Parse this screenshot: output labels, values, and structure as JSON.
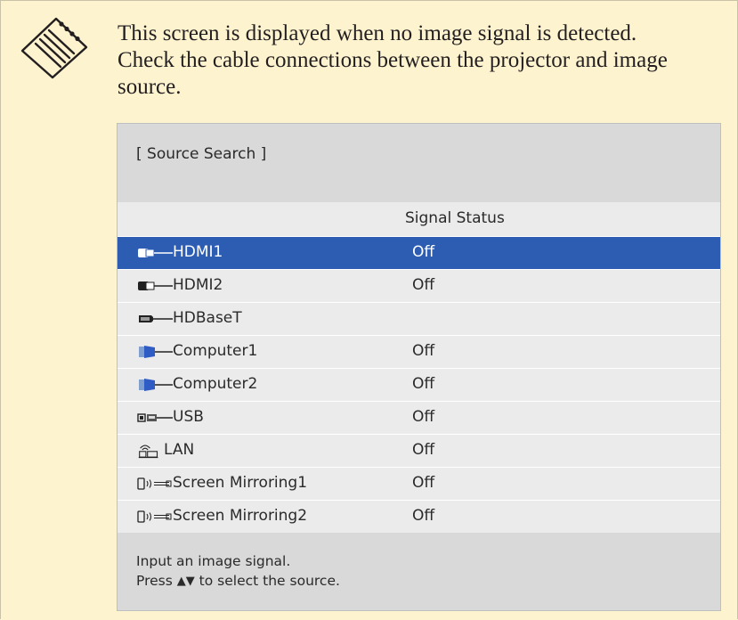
{
  "note": {
    "icon": "notepad-icon",
    "text_lines": [
      "This screen is displayed when no image signal is detected.",
      "Check the cable connections between the projector and image",
      "source."
    ]
  },
  "osd": {
    "title": "[ Source Search ]",
    "column_header": "Signal Status",
    "sources": [
      {
        "label": "HDMI1",
        "status": "Off",
        "icon": "hdmi-icon",
        "selected": true
      },
      {
        "label": "HDMI2",
        "status": "Off",
        "icon": "hdmi-icon",
        "selected": false
      },
      {
        "label": "HDBaseT",
        "status": "",
        "icon": "hdbaset-icon",
        "selected": false
      },
      {
        "label": "Computer1",
        "status": "Off",
        "icon": "vga-icon",
        "selected": false
      },
      {
        "label": "Computer2",
        "status": "Off",
        "icon": "vga-icon",
        "selected": false
      },
      {
        "label": "USB",
        "status": "Off",
        "icon": "usb-icon",
        "selected": false
      },
      {
        "label": "LAN",
        "status": "Off",
        "icon": "lan-icon",
        "selected": false
      },
      {
        "label": "Screen Mirroring1",
        "status": "Off",
        "icon": "screen-mirroring-icon",
        "selected": false
      },
      {
        "label": "Screen Mirroring2",
        "status": "Off",
        "icon": "screen-mirroring-icon",
        "selected": false
      }
    ],
    "footer_line1": "Input an image signal.",
    "footer_line2_before": "Press",
    "footer_arrows": "▲▼",
    "footer_line2_after": "to select the source.",
    "colors": {
      "selected_row": "#2c5db3",
      "panel_background": "#d9d9d9",
      "list_background": "#ebebeb",
      "note_background": "#fdf3cf"
    }
  }
}
